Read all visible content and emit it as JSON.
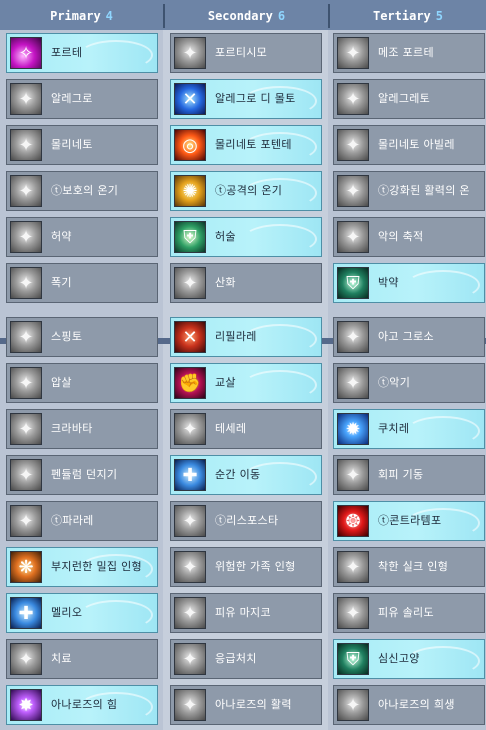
{
  "columns": [
    {
      "name": "Primary",
      "count": "4"
    },
    {
      "name": "Secondary",
      "count": "6"
    },
    {
      "name": "Tertiary",
      "count": "5"
    }
  ],
  "section1": [
    [
      {
        "label": "포르테",
        "icon": "pink-slash-icon",
        "style": "pink",
        "lit": true
      },
      {
        "label": "포르티시모",
        "icon": "gray-feather-slash-icon",
        "style": "gray",
        "lit": false
      },
      {
        "label": "메조 포르테",
        "icon": "gray-slash-icon",
        "style": "gray",
        "lit": false
      }
    ],
    [
      {
        "label": "알레그로",
        "icon": "gray-swirl-icon",
        "style": "gray",
        "lit": false
      },
      {
        "label": "알레그로 디 몰토",
        "icon": "blue-cross-slash-icon",
        "style": "blue",
        "lit": true
      },
      {
        "label": "알레그레토",
        "icon": "gray-swirl-icon",
        "style": "gray",
        "lit": false
      }
    ],
    [
      {
        "label": "몰리네토",
        "icon": "gray-whirlwind-icon",
        "style": "gray",
        "lit": false
      },
      {
        "label": "몰리네토 포텐테",
        "icon": "fire-whirlwind-icon",
        "style": "fire",
        "lit": true
      },
      {
        "label": "몰리네토 아빌레",
        "icon": "gray-whirlwind-icon",
        "style": "gray",
        "lit": false
      }
    ],
    [
      {
        "label": "ⓣ보호의 온기",
        "icon": "gray-burst-icon",
        "style": "gray",
        "lit": false
      },
      {
        "label": "ⓣ공격의 온기",
        "icon": "gold-burst-icon",
        "style": "gold",
        "lit": true
      },
      {
        "label": "ⓣ강화된 활력의 온",
        "icon": "gray-burst-icon",
        "style": "gray",
        "lit": false
      }
    ],
    [
      {
        "label": "허약",
        "icon": "gray-fist-icon",
        "style": "gray",
        "lit": false
      },
      {
        "label": "허술",
        "icon": "green-shield-icon",
        "style": "green",
        "lit": true
      },
      {
        "label": "악의 축적",
        "icon": "gray-star-icon",
        "style": "gray",
        "lit": false
      }
    ],
    [
      {
        "label": "폭기",
        "icon": "gray-explosion-icon",
        "style": "gray",
        "lit": false
      },
      {
        "label": "산화",
        "icon": "gray-crack-icon",
        "style": "gray",
        "lit": false
      },
      {
        "label": "박약",
        "icon": "green-shield-break-icon",
        "style": "teal",
        "lit": true
      }
    ]
  ],
  "section2": [
    [
      {
        "label": "스핑토",
        "icon": "gray-claw-icon",
        "style": "gray",
        "lit": false
      },
      {
        "label": "리필라레",
        "icon": "red-cross-slash-icon",
        "style": "red",
        "lit": true
      },
      {
        "label": "아고 그로소",
        "icon": "gray-wand-icon",
        "style": "gray",
        "lit": false
      }
    ],
    [
      {
        "label": "압살",
        "icon": "gray-grab-icon",
        "style": "gray",
        "lit": false
      },
      {
        "label": "교살",
        "icon": "crimson-grab-icon",
        "style": "crim",
        "lit": true
      },
      {
        "label": "ⓣ악기",
        "icon": "gray-flame-icon",
        "style": "gray",
        "lit": false
      }
    ],
    [
      {
        "label": "크라바타",
        "icon": "gray-ribbon-icon",
        "style": "gray",
        "lit": false
      },
      {
        "label": "테세레",
        "icon": "gray-knot-icon",
        "style": "gray",
        "lit": false
      },
      {
        "label": "쿠치레",
        "icon": "blue-impact-icon",
        "style": "navy",
        "lit": true
      }
    ],
    [
      {
        "label": "펜듈럼 던지기",
        "icon": "gray-throw-icon",
        "style": "gray",
        "lit": false
      },
      {
        "label": "순간 이동",
        "icon": "blue-teleport-icon",
        "style": "sky",
        "lit": true
      },
      {
        "label": "회피 기동",
        "icon": "gray-spark-icon",
        "style": "gray",
        "lit": false
      }
    ],
    [
      {
        "label": "ⓣ파라레",
        "icon": "gray-gear-icon",
        "style": "gray",
        "lit": false
      },
      {
        "label": "ⓣ리스포스타",
        "icon": "gray-gear-icon",
        "style": "gray",
        "lit": false
      },
      {
        "label": "ⓣ콘트라템포",
        "icon": "red-gear-icon",
        "style": "rose",
        "lit": true
      }
    ],
    [
      {
        "label": "부지런한 밀집 인형",
        "icon": "orange-doll-icon",
        "style": "orange",
        "lit": true
      },
      {
        "label": "위험한 가족 인형",
        "icon": "gray-doll-icon",
        "style": "gray",
        "lit": false
      },
      {
        "label": "착한 실크 인형",
        "icon": "gray-angel-doll-icon",
        "style": "gray",
        "lit": false
      }
    ],
    [
      {
        "label": "멜리오",
        "icon": "blue-heal-icon",
        "style": "sky",
        "lit": true
      },
      {
        "label": "피유 마지코",
        "icon": "gray-scroll-icon",
        "style": "gray",
        "lit": false
      },
      {
        "label": "피유 솔리도",
        "icon": "gray-shield-icon",
        "style": "gray",
        "lit": false
      }
    ],
    [
      {
        "label": "치료",
        "icon": "gray-figure-icon",
        "style": "gray",
        "lit": false
      },
      {
        "label": "응급처치",
        "icon": "gray-figure-icon",
        "style": "gray",
        "lit": false
      },
      {
        "label": "심신고양",
        "icon": "teal-figure-icon",
        "style": "teal",
        "lit": true
      }
    ],
    [
      {
        "label": "아나로즈의 힘",
        "icon": "violet-star-icon",
        "style": "violet",
        "lit": true
      },
      {
        "label": "아나로즈의 활력",
        "icon": "gray-star-icon",
        "style": "gray",
        "lit": false
      },
      {
        "label": "아나로즈의 희생",
        "icon": "gray-star-icon",
        "style": "gray",
        "lit": false
      }
    ]
  ]
}
